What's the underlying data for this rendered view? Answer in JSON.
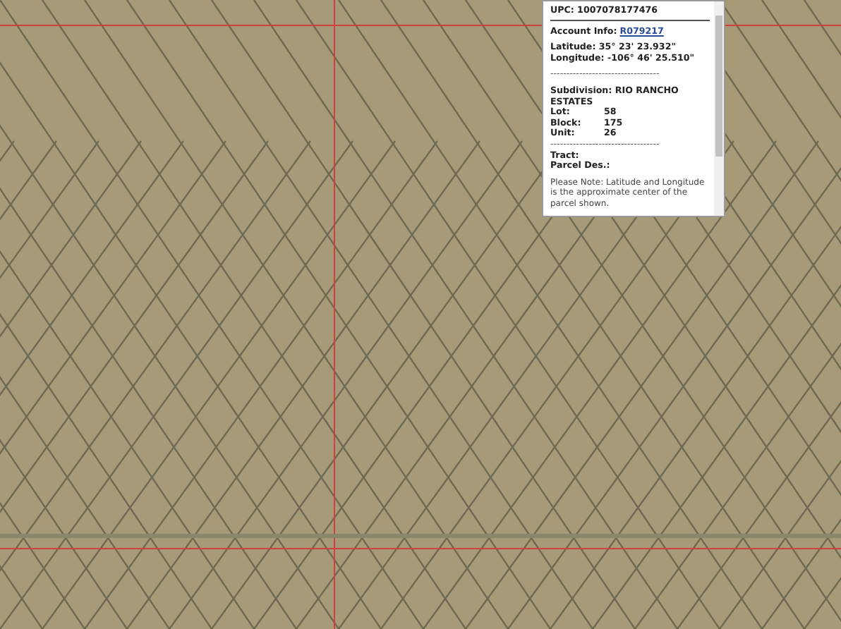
{
  "popup": {
    "upc": "UPC: 1007078177476",
    "account_label": "Account Info:",
    "account_link": "R079217",
    "latitude": "Latitude: 35° 23' 23.932\"",
    "longitude": "Longitude: -106° 46' 25.510\"",
    "separator": "----------------------------------",
    "subdivision": "Subdivision: RIO RANCHO ESTATES",
    "fields": [
      {
        "label": "Lot:",
        "value": "58"
      },
      {
        "label": "Block:",
        "value": "175"
      },
      {
        "label": "Unit:",
        "value": "26"
      }
    ],
    "separator_2": "----------------------------------",
    "tract": "Tract:",
    "parcel": "Parcel Des.:",
    "note": "Please Note: Latitude and Longitude is the approximate center of the parcel shown."
  }
}
